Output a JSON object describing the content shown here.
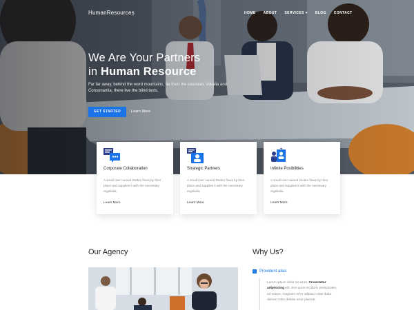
{
  "nav": {
    "brand": "HumanResources",
    "items": [
      {
        "label": "HOME"
      },
      {
        "label": "ABOUT"
      },
      {
        "label": "SERVICES",
        "dropdown": true
      },
      {
        "label": "BLOG"
      },
      {
        "label": "CONTACT"
      }
    ]
  },
  "hero": {
    "title_line1": "We Are Your Partners",
    "title_line2_prefix": "in",
    "title_line2_bold": "Human Resource",
    "subtitle": "Far far away, behind the word mountains, far from the countries Vokalia and Consonantia, there live the blind texts.",
    "cta_label": "GET STARTED",
    "secondary_link": "Learn More"
  },
  "services": [
    {
      "icon": "collaboration-chat-icon",
      "title": "Corporate Collaboration",
      "text": "A small river named Duden flows by their place and supplies it with the necessary regelialia.",
      "link": "Learn More"
    },
    {
      "icon": "strategic-partners-icon",
      "title": "Strategic Partners",
      "text": "A small river named Duden flows by their place and supplies it with the necessary regelialia.",
      "link": "Learn More"
    },
    {
      "icon": "team-possibilities-icon",
      "title": "Infinite Posibilities",
      "text": "A small river named Duden flows by their place and supplies it with the necessary regelialia.",
      "link": "Learn More"
    }
  ],
  "agency": {
    "heading": "Our Agency"
  },
  "why": {
    "heading": "Why Us?",
    "accordion_title": "Provident alias",
    "accordion_icon": "minus",
    "body_lead": "Lorem ipsum dolor sit amet,",
    "body_bold": "Cnsectetur adipisicing",
    "body_rest": "elit. Eos quos incidunt, perspiciatis, ad saepe, magnam error adipisci vitae dolor dolore! Odio debitis error placeat"
  },
  "colors": {
    "accent": "#1a73e8",
    "icon_dark": "#2a3f8f"
  }
}
